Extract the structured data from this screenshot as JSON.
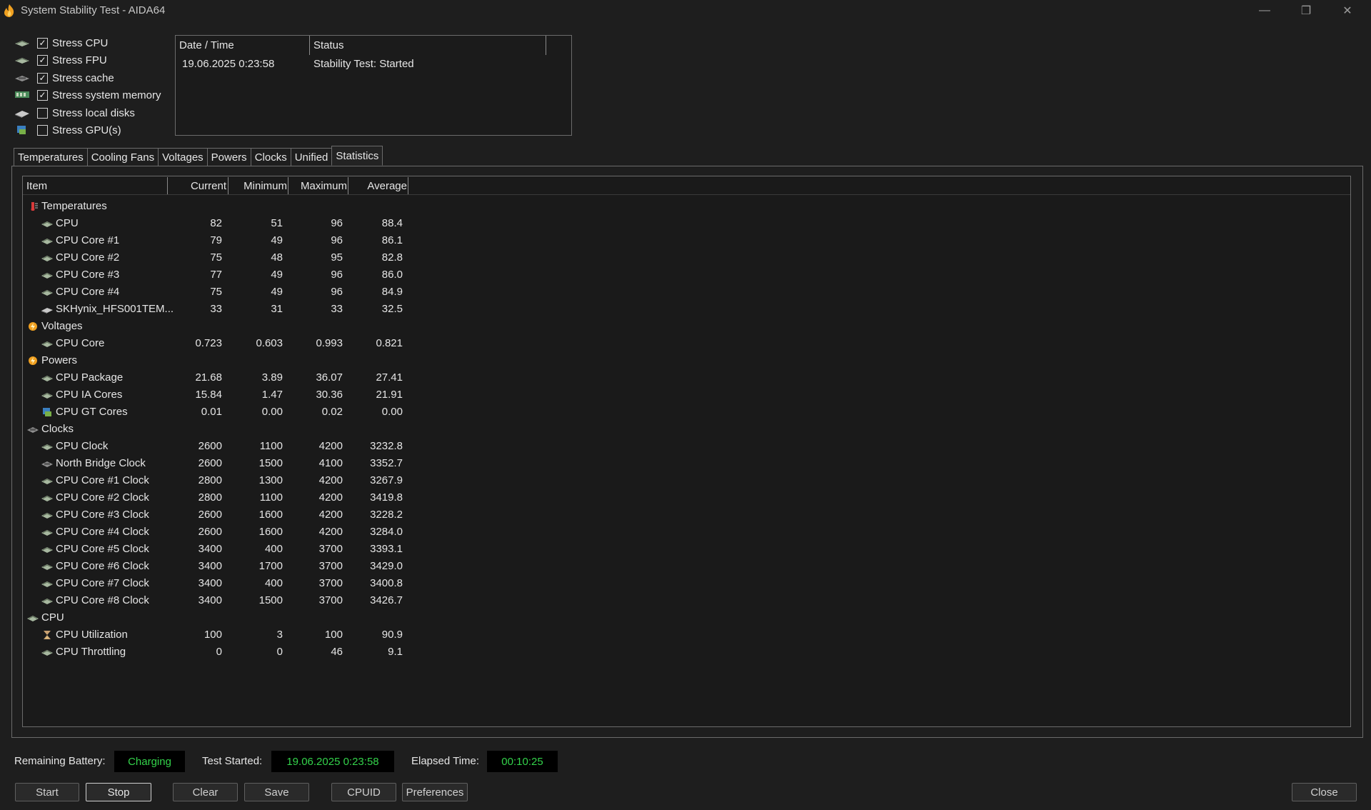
{
  "window": {
    "title": "System Stability Test - AIDA64",
    "minimize": "—",
    "maximize": "❐",
    "close": "✕"
  },
  "stress_options": [
    {
      "label": "Stress CPU",
      "checked": true,
      "icon": "cpu-chip-icon"
    },
    {
      "label": "Stress FPU",
      "checked": true,
      "icon": "fpu-chip-icon"
    },
    {
      "label": "Stress cache",
      "checked": true,
      "icon": "cache-icon"
    },
    {
      "label": "Stress system memory",
      "checked": true,
      "icon": "memory-module-icon"
    },
    {
      "label": "Stress local disks",
      "checked": false,
      "icon": "disk-icon"
    },
    {
      "label": "Stress GPU(s)",
      "checked": false,
      "icon": "gpu-icon"
    }
  ],
  "log": {
    "headers": {
      "date": "Date / Time",
      "status": "Status"
    },
    "rows": [
      {
        "date": "19.06.2025 0:23:58",
        "status": "Stability Test: Started"
      }
    ]
  },
  "tabs": [
    "Temperatures",
    "Cooling Fans",
    "Voltages",
    "Powers",
    "Clocks",
    "Unified",
    "Statistics"
  ],
  "active_tab": "Statistics",
  "stats": {
    "headers": {
      "item": "Item",
      "current": "Current",
      "minimum": "Minimum",
      "maximum": "Maximum",
      "average": "Average"
    },
    "rows": [
      {
        "group": true,
        "icon": "thermometer-icon",
        "item": "Temperatures"
      },
      {
        "icon": "cpu-chip-icon",
        "item": "CPU",
        "current": "82",
        "minimum": "51",
        "maximum": "96",
        "average": "88.4"
      },
      {
        "icon": "cpu-chip-icon",
        "item": "CPU Core #1",
        "current": "79",
        "minimum": "49",
        "maximum": "96",
        "average": "86.1"
      },
      {
        "icon": "cpu-chip-icon",
        "item": "CPU Core #2",
        "current": "75",
        "minimum": "48",
        "maximum": "95",
        "average": "82.8"
      },
      {
        "icon": "cpu-chip-icon",
        "item": "CPU Core #3",
        "current": "77",
        "minimum": "49",
        "maximum": "96",
        "average": "86.0"
      },
      {
        "icon": "cpu-chip-icon",
        "item": "CPU Core #4",
        "current": "75",
        "minimum": "49",
        "maximum": "96",
        "average": "84.9"
      },
      {
        "icon": "disk-icon",
        "item": "SKHynix_HFS001TEM...",
        "current": "33",
        "minimum": "31",
        "maximum": "33",
        "average": "32.5"
      },
      {
        "group": true,
        "icon": "voltage-icon",
        "item": "Voltages"
      },
      {
        "icon": "cpu-chip-icon",
        "item": "CPU Core",
        "current": "0.723",
        "minimum": "0.603",
        "maximum": "0.993",
        "average": "0.821"
      },
      {
        "group": true,
        "icon": "power-icon",
        "item": "Powers"
      },
      {
        "icon": "cpu-chip-icon",
        "item": "CPU Package",
        "current": "21.68",
        "minimum": "3.89",
        "maximum": "36.07",
        "average": "27.41"
      },
      {
        "icon": "cpu-chip-icon",
        "item": "CPU IA Cores",
        "current": "15.84",
        "minimum": "1.47",
        "maximum": "30.36",
        "average": "21.91"
      },
      {
        "icon": "gpu-icon",
        "item": "CPU GT Cores",
        "current": "0.01",
        "minimum": "0.00",
        "maximum": "0.02",
        "average": "0.00"
      },
      {
        "group": true,
        "icon": "clock-chip-icon",
        "item": "Clocks"
      },
      {
        "icon": "cpu-chip-icon",
        "item": "CPU Clock",
        "current": "2600",
        "minimum": "1100",
        "maximum": "4200",
        "average": "3232.8"
      },
      {
        "icon": "chipset-icon",
        "item": "North Bridge Clock",
        "current": "2600",
        "minimum": "1500",
        "maximum": "4100",
        "average": "3352.7"
      },
      {
        "icon": "cpu-chip-icon",
        "item": "CPU Core #1 Clock",
        "current": "2800",
        "minimum": "1300",
        "maximum": "4200",
        "average": "3267.9"
      },
      {
        "icon": "cpu-chip-icon",
        "item": "CPU Core #2 Clock",
        "current": "2800",
        "minimum": "1100",
        "maximum": "4200",
        "average": "3419.8"
      },
      {
        "icon": "cpu-chip-icon",
        "item": "CPU Core #3 Clock",
        "current": "2600",
        "minimum": "1600",
        "maximum": "4200",
        "average": "3228.2"
      },
      {
        "icon": "cpu-chip-icon",
        "item": "CPU Core #4 Clock",
        "current": "2600",
        "minimum": "1600",
        "maximum": "4200",
        "average": "3284.0"
      },
      {
        "icon": "cpu-chip-icon",
        "item": "CPU Core #5 Clock",
        "current": "3400",
        "minimum": "400",
        "maximum": "3700",
        "average": "3393.1"
      },
      {
        "icon": "cpu-chip-icon",
        "item": "CPU Core #6 Clock",
        "current": "3400",
        "minimum": "1700",
        "maximum": "3700",
        "average": "3429.0"
      },
      {
        "icon": "cpu-chip-icon",
        "item": "CPU Core #7 Clock",
        "current": "3400",
        "minimum": "400",
        "maximum": "3700",
        "average": "3400.8"
      },
      {
        "icon": "cpu-chip-icon",
        "item": "CPU Core #8 Clock",
        "current": "3400",
        "minimum": "1500",
        "maximum": "3700",
        "average": "3426.7"
      },
      {
        "group": true,
        "icon": "cpu-chip-icon",
        "item": "CPU"
      },
      {
        "icon": "hourglass-icon",
        "item": "CPU Utilization",
        "current": "100",
        "minimum": "3",
        "maximum": "100",
        "average": "90.9"
      },
      {
        "icon": "cpu-chip-icon",
        "item": "CPU Throttling",
        "current": "0",
        "minimum": "0",
        "maximum": "46",
        "average": "9.1"
      }
    ]
  },
  "status": {
    "battery_label": "Remaining Battery:",
    "battery_value": "Charging",
    "started_label": "Test Started:",
    "started_value": "19.06.2025 0:23:58",
    "elapsed_label": "Elapsed Time:",
    "elapsed_value": "00:10:25",
    "value_color": "#33d24a"
  },
  "buttons": {
    "start": "Start",
    "stop": "Stop",
    "clear": "Clear",
    "save": "Save",
    "cpuid": "CPUID",
    "preferences": "Preferences",
    "close": "Close"
  }
}
